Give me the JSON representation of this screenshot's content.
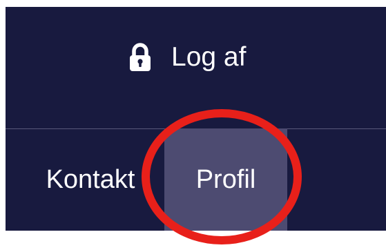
{
  "header": {
    "logout": {
      "label": "Log af",
      "icon": "lock-icon"
    }
  },
  "nav": {
    "items": [
      {
        "label": "Kontakt",
        "active": false
      },
      {
        "label": "Profil",
        "active": true
      }
    ]
  },
  "annotation": {
    "shape": "ellipse",
    "color": "#e8201a"
  },
  "colors": {
    "navbar_bg": "#181a3f",
    "active_item_bg": "#4d4b71",
    "divider": "#59597a",
    "text": "#ffffff"
  }
}
